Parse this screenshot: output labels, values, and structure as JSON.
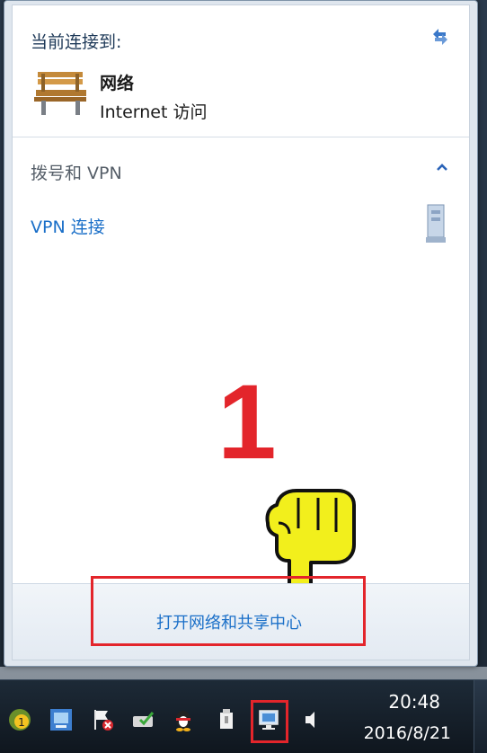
{
  "flyout": {
    "current_connection_header": "当前连接到:",
    "network_name": "网络",
    "network_status": "Internet 访问",
    "dialup_header": "拨号和 VPN",
    "vpn_link": "VPN 连接",
    "footer_link": "打开网络和共享中心"
  },
  "annotation": {
    "step_number": "1"
  },
  "taskbar": {
    "clock_time": "20:48",
    "clock_date": "2016/8/21",
    "tray_icons": [
      "notification-badge-icon",
      "monitor-app-icon",
      "action-center-flag-icon",
      "storage-check-icon",
      "qq-penguin-icon",
      "usb-device-icon",
      "network-icon",
      "volume-icon"
    ]
  },
  "colors": {
    "link": "#1a6fc8",
    "annotation_red": "#e3252b",
    "pointer_yellow": "#f2ef1c"
  }
}
